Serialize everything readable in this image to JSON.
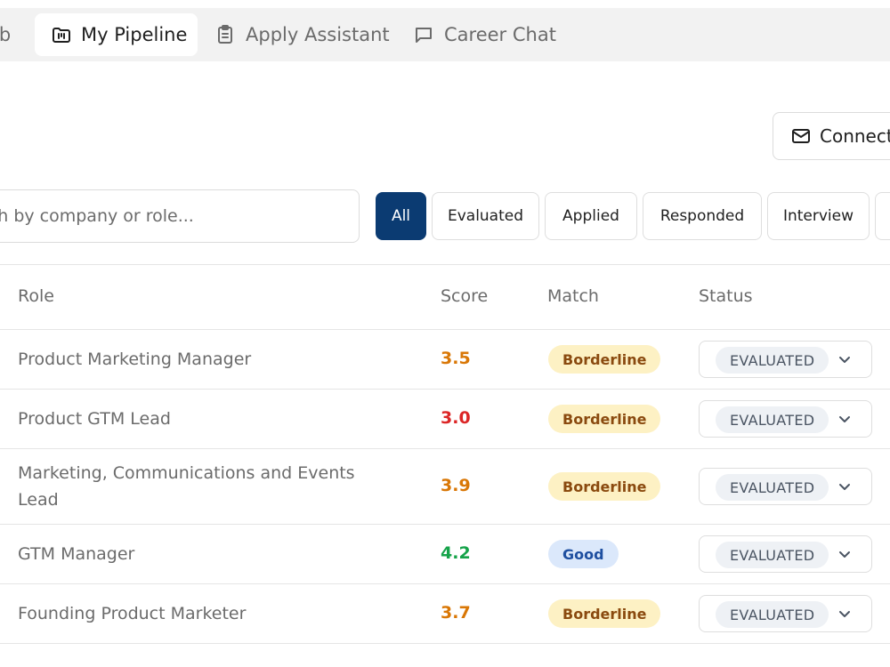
{
  "tabs": [
    {
      "label": "ob",
      "icon": "none"
    },
    {
      "label": "My Pipeline",
      "icon": "pipeline-board-icon"
    },
    {
      "label": "Apply Assistant",
      "icon": "clipboard-icon"
    },
    {
      "label": "Career Chat",
      "icon": "chat-bubble-icon"
    }
  ],
  "connect_button": {
    "label": "Connect",
    "icon": "mail-icon"
  },
  "search": {
    "placeholder": "Search by company or role...",
    "value": ""
  },
  "filters": [
    "All",
    "Evaluated",
    "Applied",
    "Responded",
    "Interview"
  ],
  "active_filter": "All",
  "table": {
    "columns": [
      "Role",
      "Score",
      "Match",
      "Status"
    ],
    "rows": [
      {
        "role": "Product Marketing Manager",
        "score": "3.5",
        "score_color": "#d97706",
        "match": "Borderline",
        "status": "EVALUATED"
      },
      {
        "role": "Product GTM Lead",
        "score": "3.0",
        "score_color": "#dc2626",
        "match": "Borderline",
        "status": "EVALUATED"
      },
      {
        "role": "Marketing, Communications and Events Lead",
        "score": "3.9",
        "score_color": "#d97706",
        "match": "Borderline",
        "status": "EVALUATED"
      },
      {
        "role": "GTM Manager",
        "score": "4.2",
        "score_color": "#16a34a",
        "match": "Good",
        "status": "EVALUATED"
      },
      {
        "role": "Founding Product Marketer",
        "score": "3.7",
        "score_color": "#d97706",
        "match": "Borderline",
        "status": "EVALUATED"
      }
    ]
  },
  "colors": {
    "accent": "#0b3b72",
    "borderline_bg": "#fdf1c4",
    "good_bg": "#dbe8fb"
  }
}
